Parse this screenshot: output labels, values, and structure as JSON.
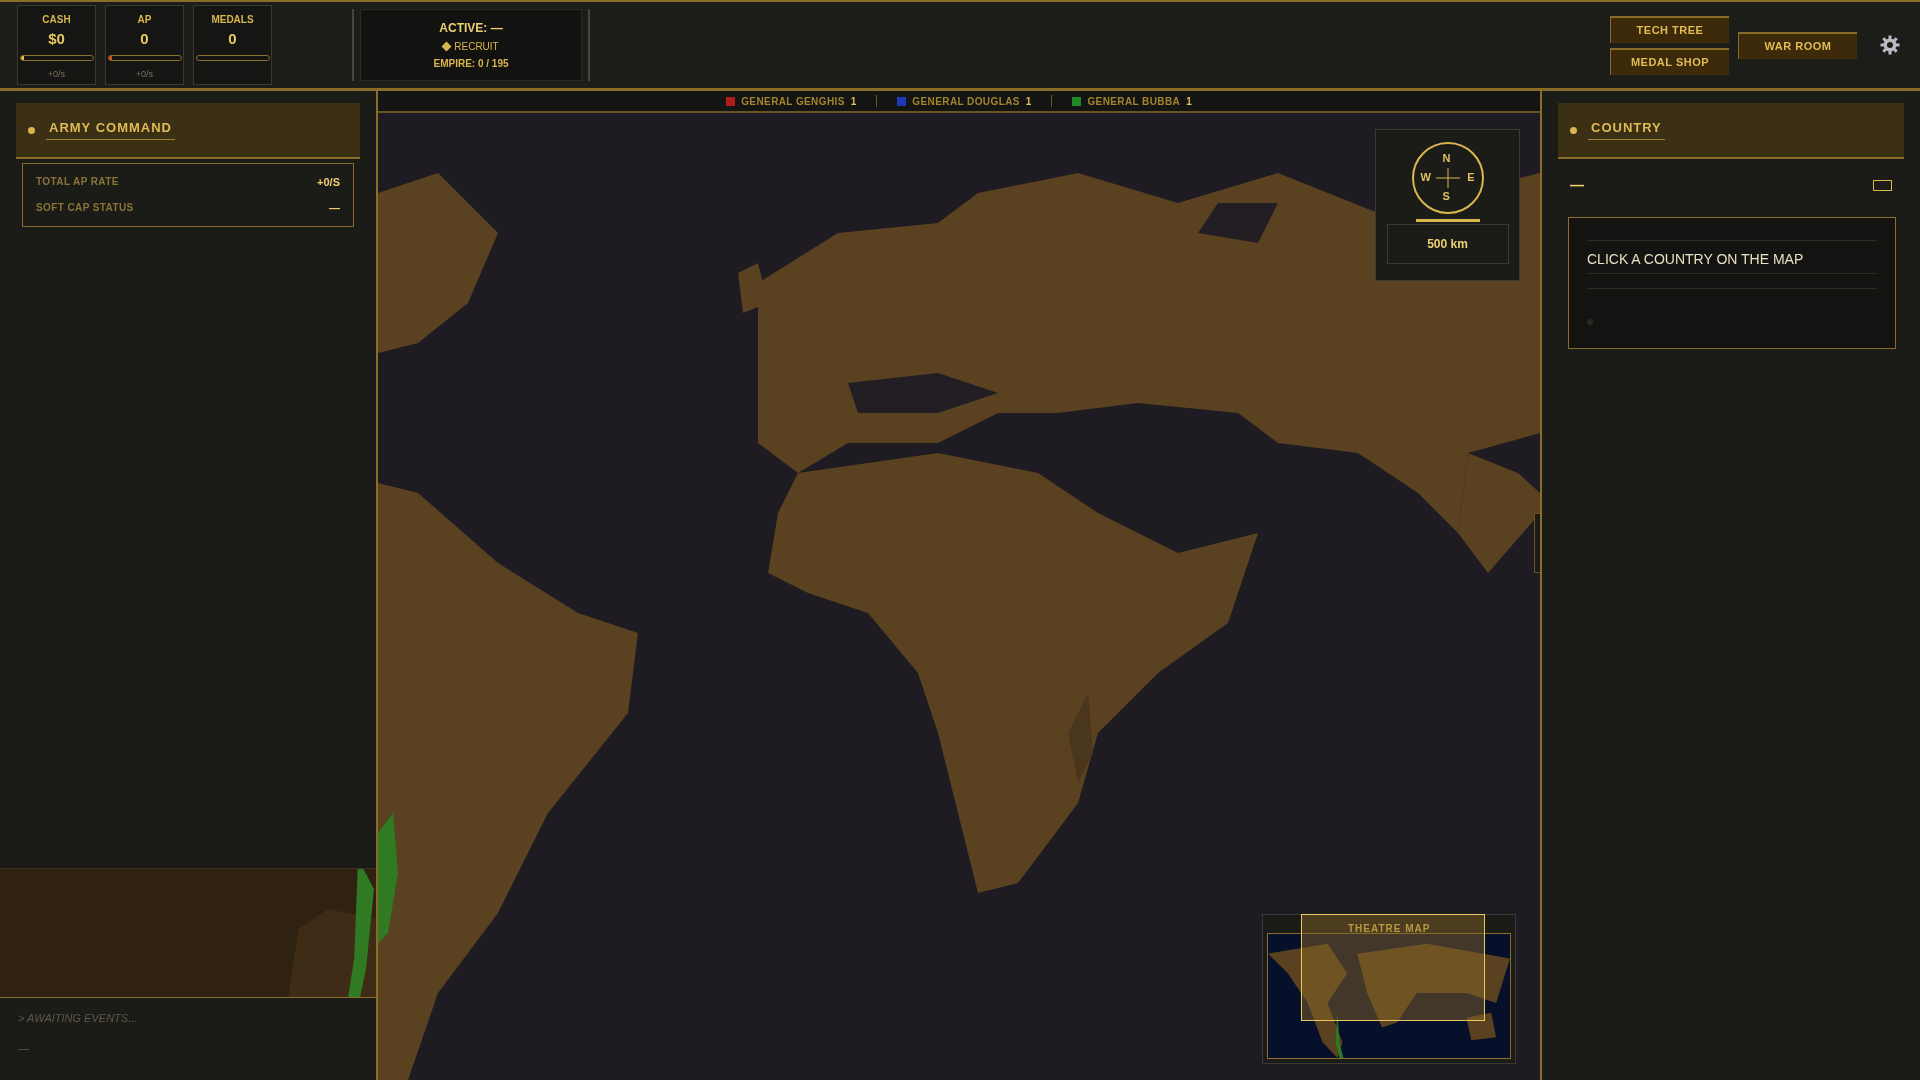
{
  "top_bar": {
    "stats": [
      {
        "label": "CASH",
        "value": "$0",
        "level": 0.05,
        "color": "#e8c04a",
        "rate": "+0/s"
      },
      {
        "label": "AP",
        "value": "0",
        "level": 0.05,
        "color": "#d9541e",
        "rate": "+0/s"
      },
      {
        "label": "MEDALS",
        "value": "0"
      }
    ],
    "active": {
      "title": "ACTIVE: —",
      "order": "RECRUIT",
      "empire": "EMPIRE: 0 / 195"
    },
    "buttons": [
      "TECH TREE",
      "MEDAL SHOP",
      "WAR ROOM"
    ]
  },
  "army_command": {
    "title": "ARMY COMMAND",
    "rows": [
      {
        "label": "TOTAL AP RATE",
        "value": "+0/S"
      },
      {
        "label": "SOFT CAP STATUS",
        "value": "—"
      }
    ]
  },
  "event_log": {
    "lines": [
      "> AWAITING EVENTS...",
      "—"
    ]
  },
  "map": {
    "legend": [
      {
        "name": "GENERAL GENGHIS",
        "count": "1",
        "color": "#b01c1c"
      },
      {
        "name": "GENERAL DOUGLAS",
        "count": "1",
        "color": "#2038b8"
      },
      {
        "name": "GENERAL BUBBA",
        "count": "1",
        "color": "#1e8a24"
      }
    ],
    "compass": {
      "north": "N",
      "west": "W",
      "east": "E",
      "south": "S",
      "scale": "500 km"
    },
    "minimap": {
      "title": "THEATRE MAP"
    }
  },
  "country": {
    "title": "COUNTRY",
    "name": "—",
    "message": "CLICK A COUNTRY ON THE MAP"
  }
}
